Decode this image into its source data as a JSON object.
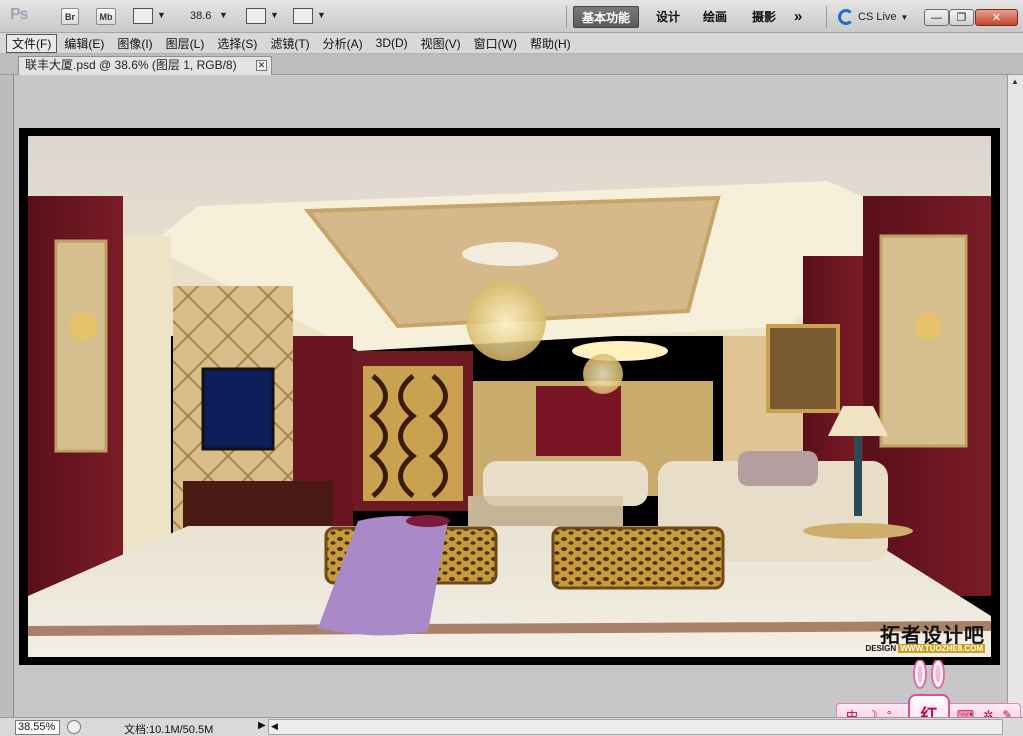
{
  "app": {
    "logo": "Ps",
    "bridge_label": "Br",
    "minibridge_label": "Mb",
    "zoom_value": "38.6",
    "workspaces": [
      "基本功能",
      "设计",
      "绘画",
      "摄影"
    ],
    "more_label": "»",
    "cslive_label": "CS Live"
  },
  "window_controls": {
    "minimize": "—",
    "restore": "❐",
    "close": "✕"
  },
  "menu": [
    "文件(F)",
    "编辑(E)",
    "图像(I)",
    "图层(L)",
    "选择(S)",
    "滤镜(T)",
    "分析(A)",
    "3D(D)",
    "视图(V)",
    "窗口(W)",
    "帮助(H)"
  ],
  "document": {
    "tab_title": "联丰大厦.psd @ 38.6% (图层 1, RGB/8)",
    "tab_close": "✕",
    "watermark_main": "拓者设计吧",
    "watermark_prefix": "DESIGN",
    "watermark_url": "WWW.TUOZHE8.COM"
  },
  "status": {
    "zoom": "38.55%",
    "doc_size": "文档:10.1M/50.5M"
  },
  "ime": {
    "chinese": "中",
    "moon": "☽",
    "punct": "°,",
    "badge": "红",
    "keyboard": "⌨",
    "tools": "✲",
    "wrench": "✎"
  }
}
